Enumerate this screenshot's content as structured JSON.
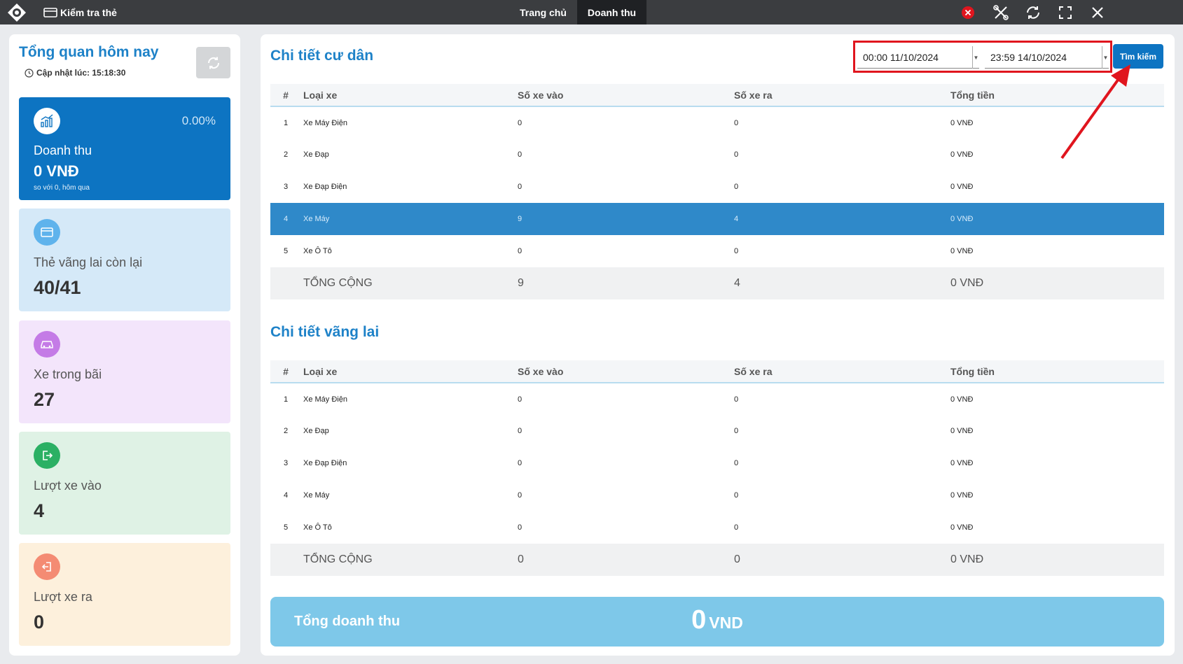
{
  "topbar": {
    "check_card_label": "Kiểm tra thẻ",
    "tabs": [
      {
        "label": "Trang chủ"
      },
      {
        "label": "Doanh thu"
      }
    ]
  },
  "sidebar": {
    "title": "Tổng quan hôm nay",
    "updated": "Cập nhật lúc: 15:18:30",
    "revenue": {
      "percent": "0.00%",
      "label": "Doanh thu",
      "value": "0 VNĐ",
      "compare": "so với 0, hôm qua"
    },
    "cards": [
      {
        "label": "Thẻ vãng lai còn lại",
        "value": "40/41",
        "color": "#d5e9f8",
        "icon_color": "#5fb3ec"
      },
      {
        "label": "Xe trong bãi",
        "value": "27",
        "color": "#f3e5fb",
        "icon_color": "#c47be6"
      },
      {
        "label": "Lượt xe vào",
        "value": "4",
        "color": "#dff2e5",
        "icon_color": "#2bb064"
      },
      {
        "label": "Lượt xe ra",
        "value": "0",
        "color": "#fdf0dc",
        "icon_color": "#f48b73"
      }
    ]
  },
  "main": {
    "resident_title": "Chi tiết cư dân",
    "guest_title": "Chi tiết vãng lai",
    "date_from": "00:00 11/10/2024",
    "date_to": "23:59 14/10/2024",
    "search_label": "Tìm kiếm",
    "columns": [
      "#",
      "Loại xe",
      "Số xe vào",
      "Số xe ra",
      "Tổng tiền"
    ],
    "resident_rows": [
      [
        "1",
        "Xe Máy Điện",
        "0",
        "0",
        "0 VNĐ"
      ],
      [
        "2",
        "Xe Đạp",
        "0",
        "0",
        "0 VNĐ"
      ],
      [
        "3",
        "Xe Đạp Điện",
        "0",
        "0",
        "0 VNĐ"
      ],
      [
        "4",
        "Xe Máy",
        "9",
        "4",
        "0 VNĐ"
      ],
      [
        "5",
        "Xe Ô Tô",
        "0",
        "0",
        "0 VNĐ"
      ]
    ],
    "resident_total": [
      "TỔNG CỘNG",
      "9",
      "4",
      "0 VNĐ"
    ],
    "guest_rows": [
      [
        "1",
        "Xe Máy Điện",
        "0",
        "0",
        "0 VNĐ"
      ],
      [
        "2",
        "Xe Đạp",
        "0",
        "0",
        "0 VNĐ"
      ],
      [
        "3",
        "Xe Đạp Điện",
        "0",
        "0",
        "0 VNĐ"
      ],
      [
        "4",
        "Xe Máy",
        "0",
        "0",
        "0 VNĐ"
      ],
      [
        "5",
        "Xe Ô Tô",
        "0",
        "0",
        "0 VNĐ"
      ]
    ],
    "guest_total": [
      "TỔNG CỘNG",
      "0",
      "0",
      "0 VNĐ"
    ],
    "total_revenue_label": "Tổng doanh thu",
    "total_revenue_value": "0",
    "total_revenue_unit": "VND"
  }
}
